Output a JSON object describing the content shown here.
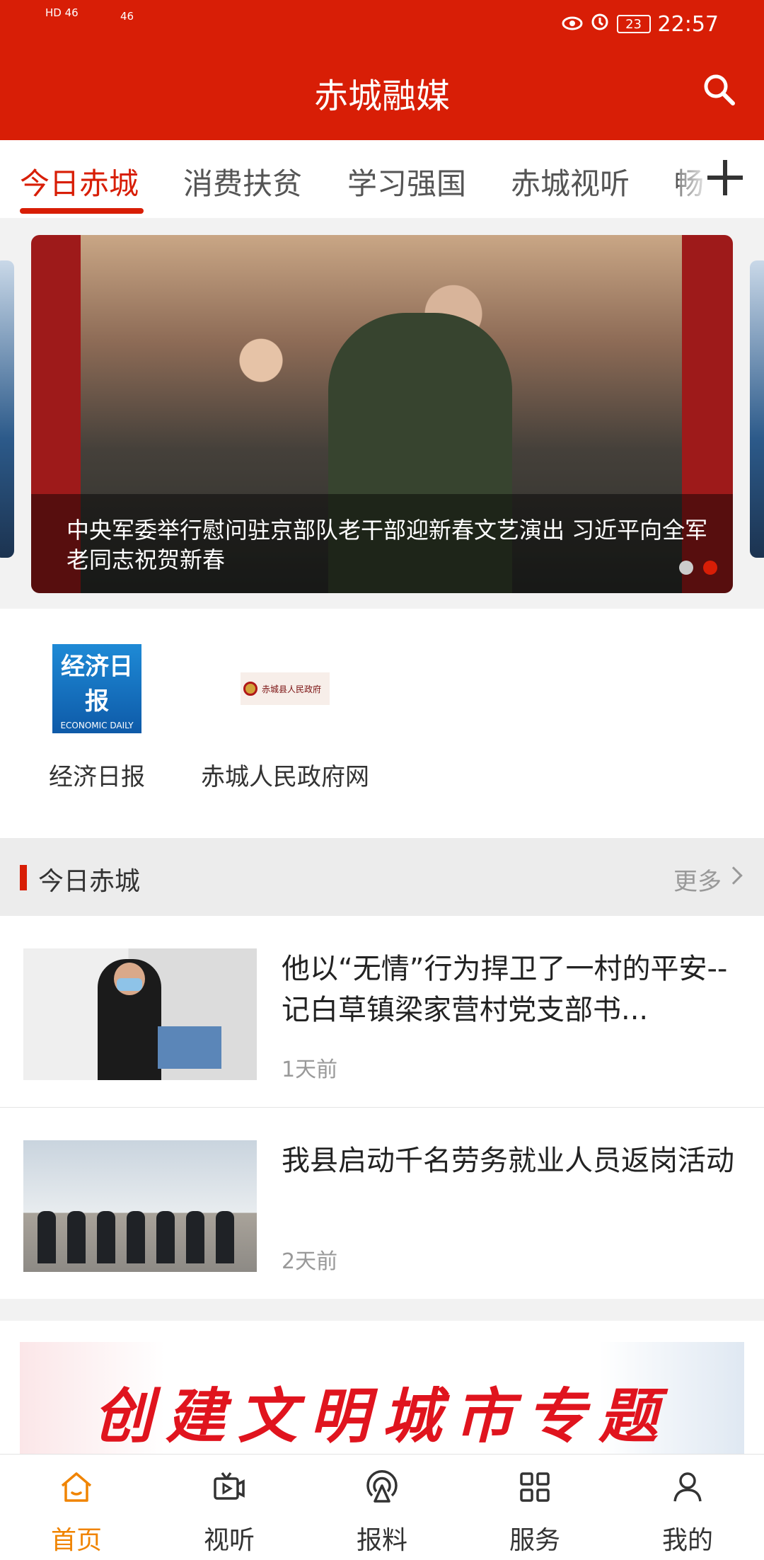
{
  "status_bar": {
    "time": "22:57",
    "battery": "23",
    "signal_left": "HD 46",
    "signal_right": "46"
  },
  "header": {
    "title": "赤城融媒",
    "search_icon": "search-icon"
  },
  "tabs": [
    {
      "label": "今日赤城",
      "active": true
    },
    {
      "label": "消费扶贫",
      "active": false
    },
    {
      "label": "学习强国",
      "active": false
    },
    {
      "label": "赤城视听",
      "active": false
    },
    {
      "label": "畅",
      "active": false
    }
  ],
  "banner": {
    "caption": "中央军委举行慰问驻京部队老干部迎新春文艺演出 习近平向全军老同志祝贺新春",
    "dot_count": 2,
    "active_dot": 2
  },
  "shortcuts": [
    {
      "label": "经济日报",
      "logo_text": "经济日报",
      "logo_sub": "ECONOMIC DAILY"
    },
    {
      "label": "赤城人民政府网",
      "logo_text": "赤城县人民政府"
    }
  ],
  "section": {
    "title": "今日赤城",
    "more": "更多"
  },
  "news": [
    {
      "title": "他以“无情”行为捍卫了一村的平安--记白草镇梁家营村党支部书...",
      "time": "1天前"
    },
    {
      "title": "我县启动千名劳务就业人员返岗活动",
      "time": "2天前"
    }
  ],
  "promo": {
    "text": "创建文明城市专题"
  },
  "bottom_nav": [
    {
      "label": "首页",
      "icon": "home-icon",
      "active": true
    },
    {
      "label": "视听",
      "icon": "video-icon",
      "active": false
    },
    {
      "label": "报料",
      "icon": "broadcast-icon",
      "active": false
    },
    {
      "label": "服务",
      "icon": "grid-icon",
      "active": false
    },
    {
      "label": "我的",
      "icon": "user-icon",
      "active": false
    }
  ],
  "colors": {
    "brand_red": "#d81e06",
    "nav_active": "#f08400"
  }
}
